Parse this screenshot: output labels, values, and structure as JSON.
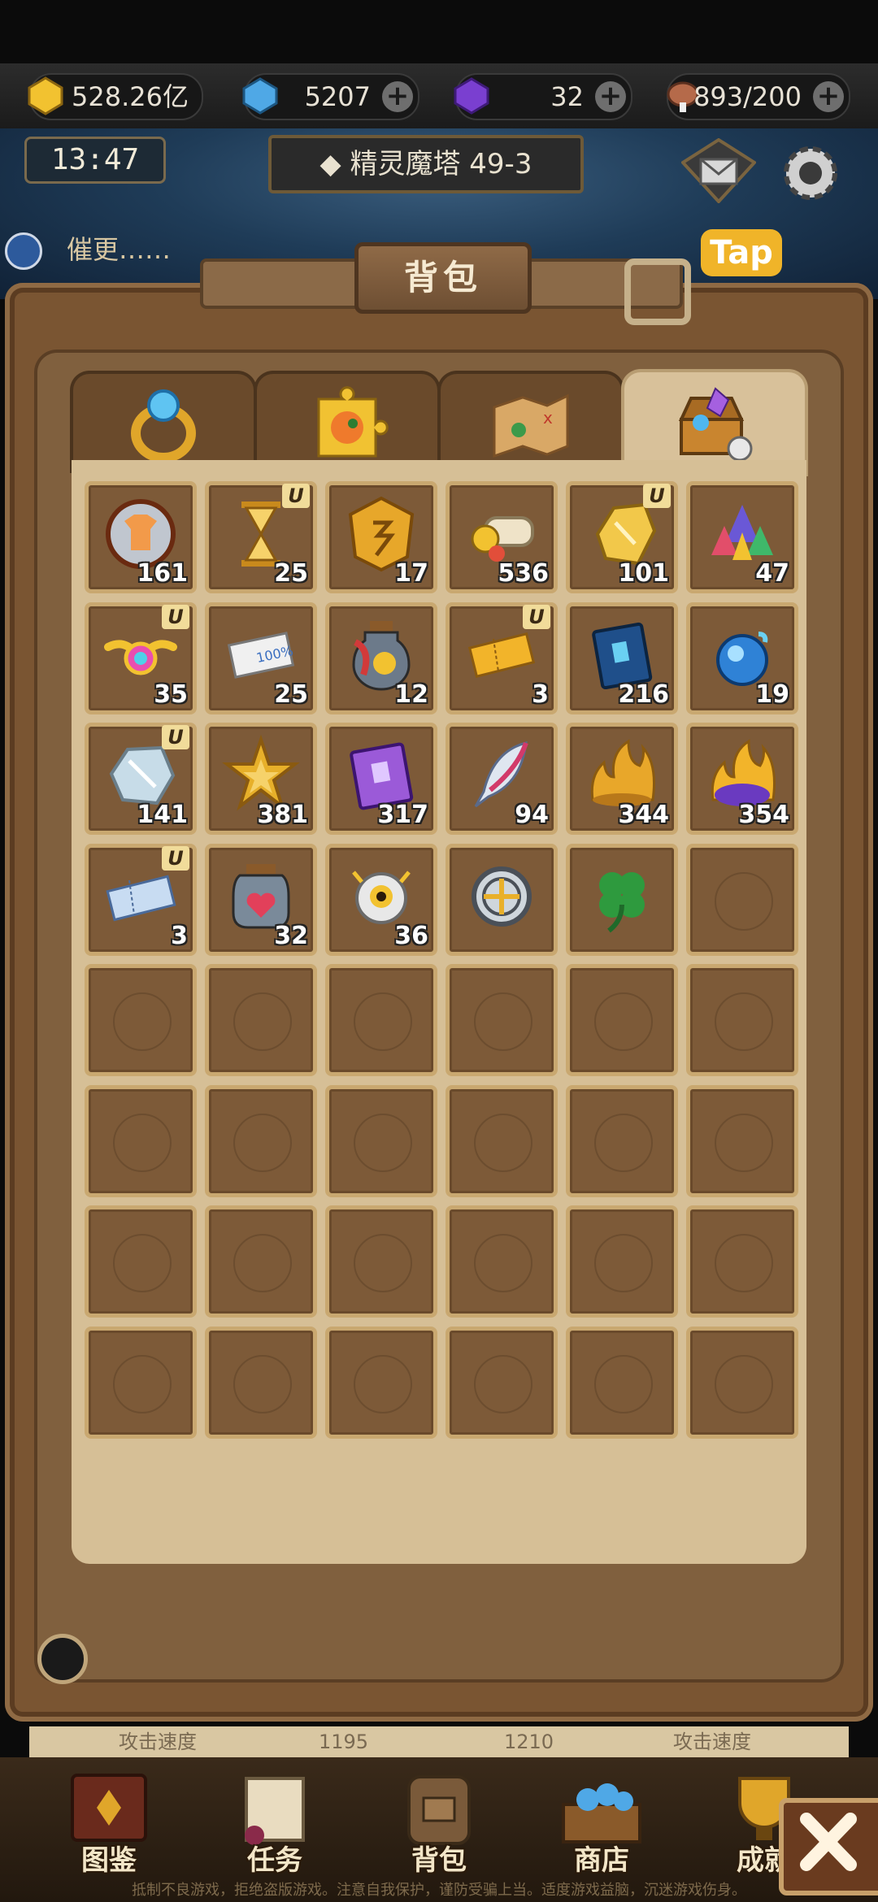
{
  "resources": {
    "gold": "528.26亿",
    "blue_gem": "5207",
    "purple_gem": "32",
    "stamina": "893/200",
    "plus": "+"
  },
  "header": {
    "time": "13:47",
    "stage": "◆ 精灵魔塔 49-3",
    "notice": "催更……",
    "tap_logo": "Tap"
  },
  "panel": {
    "title": "背包"
  },
  "tabs": [
    {
      "icon": "ring-icon"
    },
    {
      "icon": "puzzle-creature-icon"
    },
    {
      "icon": "treasure-map-icon"
    },
    {
      "icon": "treasure-chest-icon",
      "active": true
    }
  ],
  "items": [
    {
      "icon": "shirt-medal-icon",
      "count": "161",
      "u": false
    },
    {
      "icon": "hourglass-icon",
      "count": "25",
      "u": true
    },
    {
      "icon": "gold-rune-tablet-icon",
      "count": "17",
      "u": false
    },
    {
      "icon": "scroll-coin-icon",
      "count": "536",
      "u": false
    },
    {
      "icon": "gold-ore-icon",
      "count": "101",
      "u": true
    },
    {
      "icon": "rainbow-crystals-icon",
      "count": "47",
      "u": false
    },
    {
      "icon": "winged-gem-icon",
      "count": "35",
      "u": true
    },
    {
      "icon": "coupon-100-icon",
      "count": "25",
      "u": false
    },
    {
      "icon": "potion-bottle-icon",
      "count": "12",
      "u": false
    },
    {
      "icon": "gold-ticket-icon",
      "count": "3",
      "u": true
    },
    {
      "icon": "blue-book-icon",
      "count": "216",
      "u": false
    },
    {
      "icon": "blue-flame-orb-icon",
      "count": "19",
      "u": false
    },
    {
      "icon": "silver-ore-icon",
      "count": "141",
      "u": true
    },
    {
      "icon": "star-fragment-icon",
      "count": "381",
      "u": false
    },
    {
      "icon": "purple-book-icon",
      "count": "317",
      "u": false
    },
    {
      "icon": "feather-icon",
      "count": "94",
      "u": false
    },
    {
      "icon": "gold-flame-icon",
      "count": "344",
      "u": false
    },
    {
      "icon": "purple-flame-icon",
      "count": "354",
      "u": false
    },
    {
      "icon": "blue-ticket-icon",
      "count": "3",
      "u": true
    },
    {
      "icon": "heart-jar-icon",
      "count": "32",
      "u": false
    },
    {
      "icon": "eye-orb-icon",
      "count": "36",
      "u": false
    },
    {
      "icon": "silver-wheel-icon",
      "count": "",
      "u": false
    },
    {
      "icon": "clover-icon",
      "count": "",
      "u": false
    }
  ],
  "stat_bar": {
    "left_label": "攻击速度",
    "mid1": "1195",
    "mid2": "1210",
    "right_label": "攻击速度"
  },
  "nav": [
    {
      "label": "图鉴"
    },
    {
      "label": "任务"
    },
    {
      "label": "背包"
    },
    {
      "label": "商店"
    },
    {
      "label": "成就"
    }
  ],
  "footer": "抵制不良游戏，拒绝盗版游戏。注意自我保护，谨防受骗上当。适度游戏益脑，沉迷游戏伤身。"
}
